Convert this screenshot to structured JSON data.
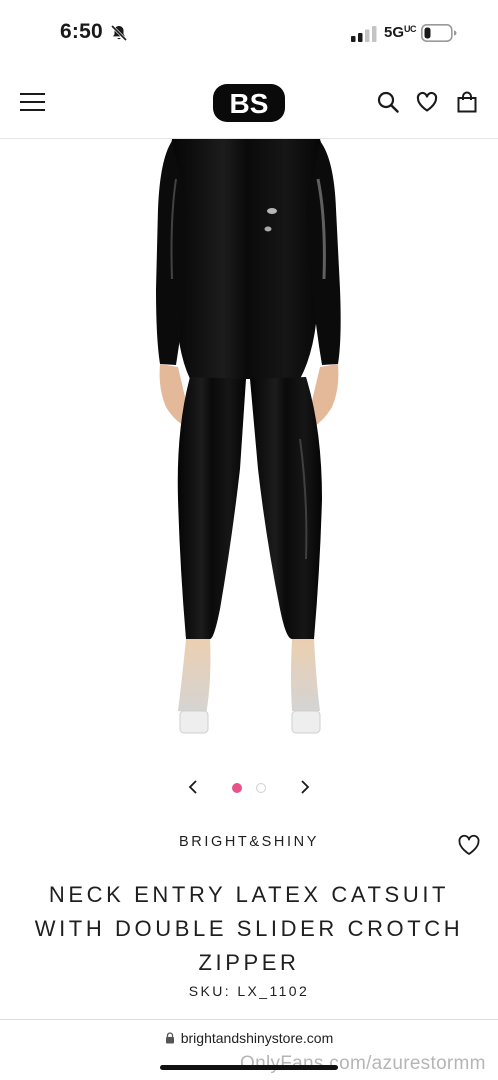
{
  "status_bar": {
    "time": "6:50",
    "network": "5G",
    "network_sub": "UC",
    "silent_icon": "bell-slash-icon",
    "signal_icon": "signal-bars-icon",
    "battery_icon": "battery-low-icon"
  },
  "header": {
    "logo_text": "BS",
    "menu_icon": "hamburger-menu-icon",
    "search_icon": "search-icon",
    "wishlist_icon": "heart-icon",
    "cart_icon": "shopping-bag-icon"
  },
  "product": {
    "image_alt": "black latex catsuit with clear heels",
    "carousel_prev_icon": "chevron-left-icon",
    "carousel_next_icon": "chevron-right-icon",
    "carousel_active_color": "#e8528a",
    "brand": "BRIGHT&SHINY",
    "title": "NECK ENTRY LATEX CATSUIT WITH DOUBLE SLIDER CROTCH ZIPPER",
    "sku": "SKU: LX_1102",
    "wishlist_icon": "heart-outline-icon"
  },
  "browser": {
    "url": "brightandshinystore.com",
    "lock_icon": "lock-icon"
  },
  "watermark": "OnlyFans.com/azurestormm"
}
